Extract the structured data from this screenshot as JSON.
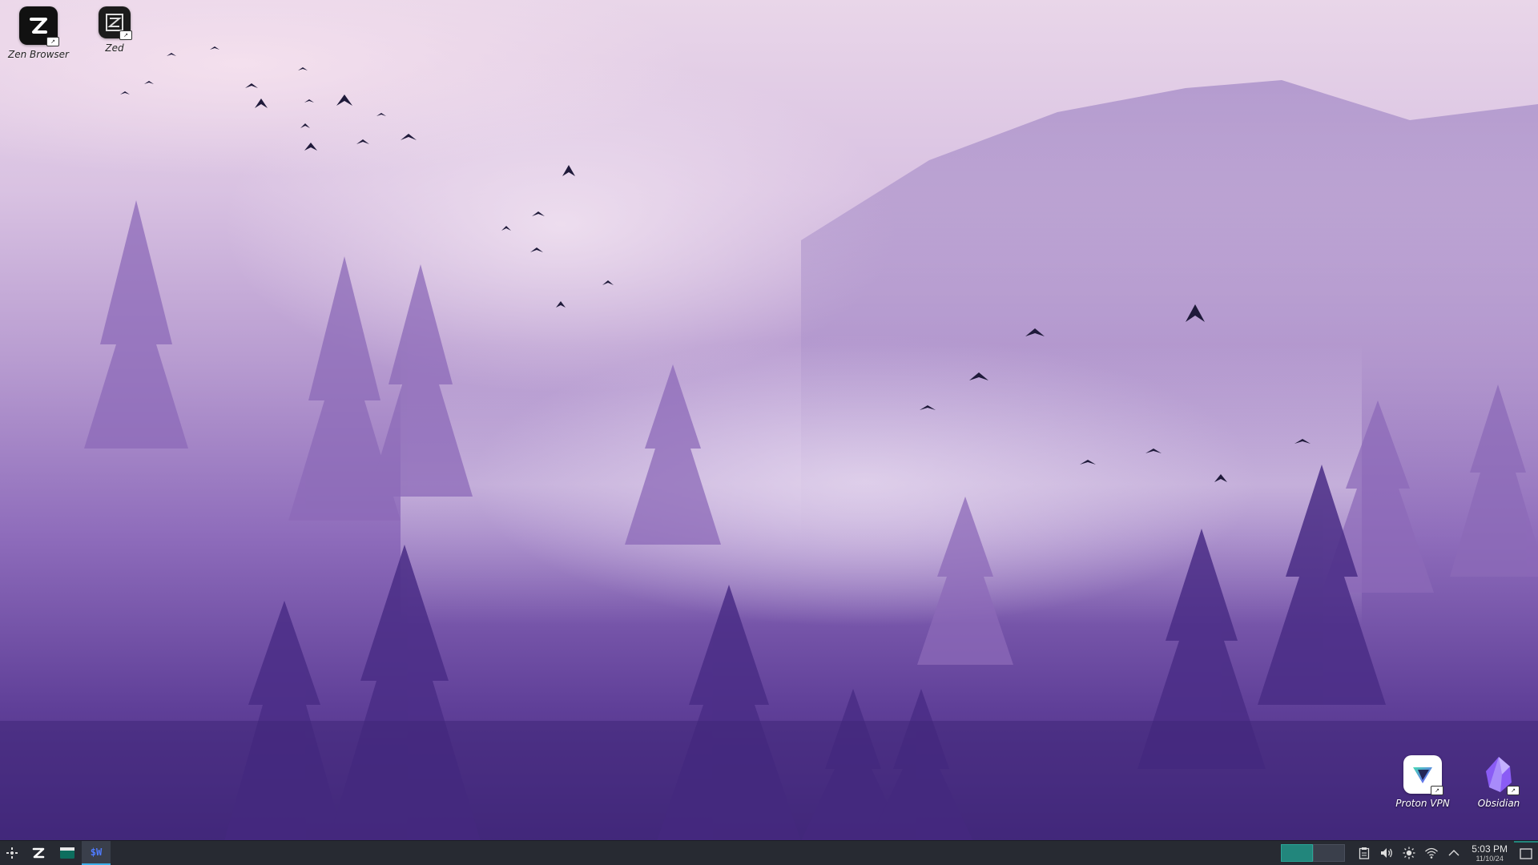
{
  "desktop": {
    "icons": [
      {
        "label": "Zen Browser",
        "icon": "zen-browser-icon"
      },
      {
        "label": "Zed",
        "icon": "zed-editor-icon"
      },
      {
        "label": "Proton VPN",
        "icon": "proton-vpn-icon"
      },
      {
        "label": "Obsidian",
        "icon": "obsidian-icon"
      }
    ]
  },
  "taskbar": {
    "launcher_icon": "application-launcher-icon",
    "tasks": [
      {
        "icon": "zen-browser-icon"
      },
      {
        "icon": "terminal-icon"
      },
      {
        "icon": "sw-app-icon",
        "glyph": "$W",
        "active": true
      }
    ],
    "pager": {
      "desktops": 2,
      "current": 1
    },
    "tray": [
      "clipboard-icon",
      "volume-icon",
      "brightness-icon",
      "wifi-icon",
      "expand-tray-icon"
    ],
    "clock": {
      "time": "5:03 PM",
      "date": "11/10/24"
    }
  },
  "colors": {
    "taskbar_bg": "#272a32",
    "accent": "#22867c",
    "sky": "#e9d6e9",
    "forest": "#5f3f98"
  }
}
